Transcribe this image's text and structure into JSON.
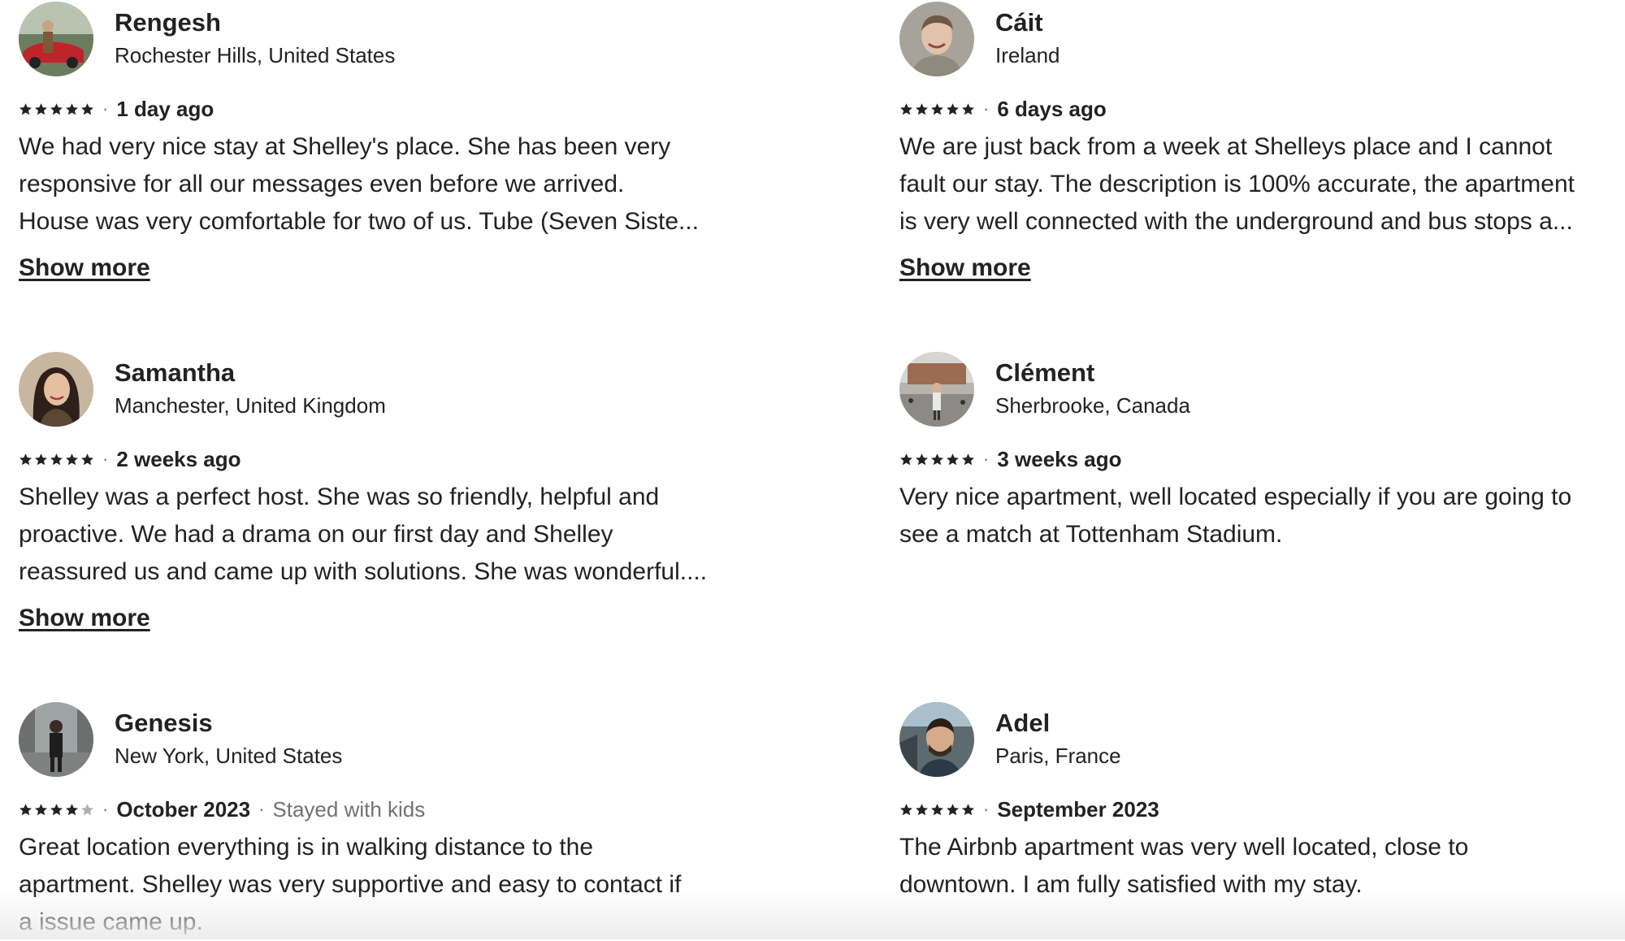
{
  "reviews": [
    {
      "name": "Rengesh",
      "location": "Rochester Hills, United States",
      "rating": 5,
      "date": "1 day ago",
      "trip_type": "",
      "text_lines": [
        "We had very nice stay at Shelley's place. She has been very",
        "responsive for all our messages even before we arrived.",
        "House was very comfortable for two of us. Tube (Seven Siste..."
      ],
      "show_more": "Show more",
      "avatar_icon": "avatar-photo-person-with-red-car"
    },
    {
      "name": "Cáit",
      "location": "Ireland",
      "rating": 5,
      "date": "6 days ago",
      "trip_type": "",
      "text_lines": [
        "We are just back from a week at Shelleys place and I cannot",
        "fault our stay. The description is 100% accurate, the apartment",
        "is very well connected with the underground and bus stops a..."
      ],
      "show_more": "Show more",
      "avatar_icon": "avatar-photo-smiling-person"
    },
    {
      "name": "Samantha",
      "location": "Manchester, United Kingdom",
      "rating": 5,
      "date": "2 weeks ago",
      "trip_type": "",
      "text_lines": [
        "Shelley was a perfect host. She was so friendly, helpful and",
        "proactive. We had a drama on our first day and Shelley",
        "reassured us and came up with solutions. She was wonderful...."
      ],
      "show_more": "Show more",
      "avatar_icon": "avatar-photo-woman-dark-hair"
    },
    {
      "name": "Clément",
      "location": "Sherbrooke, Canada",
      "rating": 5,
      "date": "3 weeks ago",
      "trip_type": "",
      "text_lines": [
        "Very nice apartment, well located especially if you are going to",
        "see a match at Tottenham Stadium."
      ],
      "show_more": "",
      "avatar_icon": "avatar-photo-person-in-plaza"
    },
    {
      "name": "Genesis",
      "location": "New York, United States",
      "rating": 4,
      "date": "October 2023",
      "trip_type": "Stayed with kids",
      "text_lines": [
        "Great location everything is in walking distance to the",
        "apartment. Shelley was very supportive and easy to contact if",
        "a issue came up."
      ],
      "show_more": "",
      "avatar_icon": "avatar-photo-person-on-street"
    },
    {
      "name": "Adel",
      "location": "Paris, France",
      "rating": 5,
      "date": "September 2023",
      "trip_type": "",
      "text_lines": [
        "The Airbnb apartment was very well located, close to",
        "downtown. I am fully satisfied with my stay."
      ],
      "show_more": "",
      "avatar_icon": "avatar-photo-bearded-man-in-car"
    }
  ],
  "colors": {
    "text": "#222222",
    "muted": "#717171",
    "star_filled": "#222222",
    "star_empty": "#b0b0b0"
  }
}
